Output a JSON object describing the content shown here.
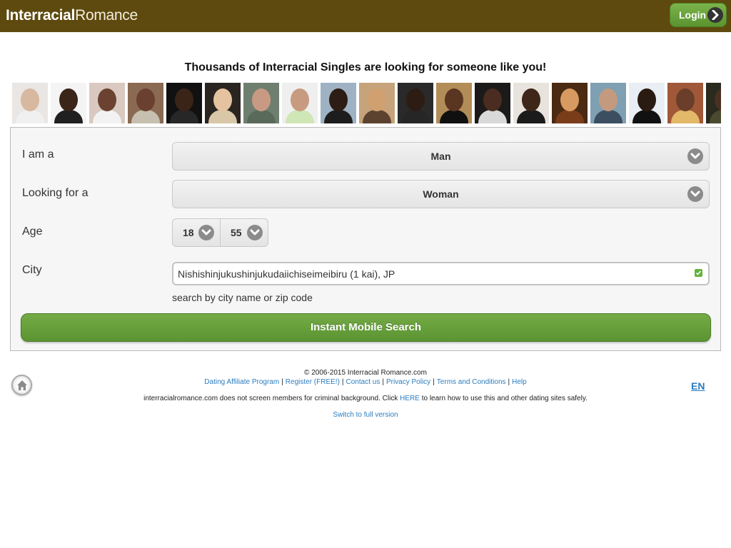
{
  "header": {
    "logo_bold": "Interracial",
    "logo_light": "Romance",
    "login_label": "Login"
  },
  "headline": "Thousands of Interracial Singles are looking for someone like you!",
  "photos": [
    {
      "bg": "#e9e6e3",
      "skin": "#d8b8a0",
      "shirt": "#f0f0f0"
    },
    {
      "bg": "#f4f4f4",
      "skin": "#3b2418",
      "shirt": "#202020"
    },
    {
      "bg": "#d9c9c0",
      "skin": "#6b4231",
      "shirt": "#f2f2f2"
    },
    {
      "bg": "#8a6a52",
      "skin": "#6a4030",
      "shirt": "#c7c0b0"
    },
    {
      "bg": "#111111",
      "skin": "#3a2418",
      "shirt": "#272727"
    },
    {
      "bg": "#2a2521",
      "skin": "#e6c3a0",
      "shirt": "#d9c8a8"
    },
    {
      "bg": "#6f7f6f",
      "skin": "#c99a83",
      "shirt": "#5a6a5a"
    },
    {
      "bg": "#efefef",
      "skin": "#c79b80",
      "shirt": "#cfe6b7"
    },
    {
      "bg": "#9eb2c4",
      "skin": "#2d1d14",
      "shirt": "#1d1d1d"
    },
    {
      "bg": "#c6a37a",
      "skin": "#d1a070",
      "shirt": "#5b4330"
    },
    {
      "bg": "#2a2a2a",
      "skin": "#2d1c14",
      "shirt": "#262626"
    },
    {
      "bg": "#b38d57",
      "skin": "#5a3522",
      "shirt": "#101010"
    },
    {
      "bg": "#1c1a18",
      "skin": "#4a2d20",
      "shirt": "#d9d9d9"
    },
    {
      "bg": "#e8e3dc",
      "skin": "#3e2619",
      "shirt": "#1b1b1b"
    },
    {
      "bg": "#4a2a12",
      "skin": "#d79a60",
      "shirt": "#7a3d1a"
    },
    {
      "bg": "#7f9fb3",
      "skin": "#c49a7f",
      "shirt": "#3b4f60"
    },
    {
      "bg": "#e8eef3",
      "skin": "#2a1b12",
      "shirt": "#111111"
    },
    {
      "bg": "#a05838",
      "skin": "#6a3e28",
      "shirt": "#e3b868"
    },
    {
      "bg": "#2a2a1e",
      "skin": "#4a3020",
      "shirt": "#4a4a30"
    }
  ],
  "form": {
    "iam_label": "I am a",
    "iam_value": "Man",
    "looking_label": "Looking for a",
    "looking_value": "Woman",
    "age_label": "Age",
    "age_min": "18",
    "age_max": "55",
    "city_label": "City",
    "city_value": "Nishishinjukushinjukudaiichiseimeibiru (1 kai), JP",
    "city_hint": "search by city name or zip code",
    "search_button": "Instant Mobile Search"
  },
  "footer": {
    "copyright": "© 2006-2015 Interracial Romance.com",
    "links": [
      "Dating Affiliate Program",
      "Register (FREE!)",
      "Contact us",
      "Privacy Policy",
      "Terms and Conditions",
      "Help"
    ],
    "disclaimer_before": "interracialromance.com does not screen members for criminal background. Click",
    "disclaimer_link": "HERE",
    "disclaimer_after": "to learn how to use this and other dating sites safely.",
    "switch_link": "Switch to full version",
    "lang": "EN"
  },
  "colors": {
    "header_bg": "#5e4a0e",
    "button_green": "#5b9432",
    "link_blue": "#2b7cbf"
  }
}
